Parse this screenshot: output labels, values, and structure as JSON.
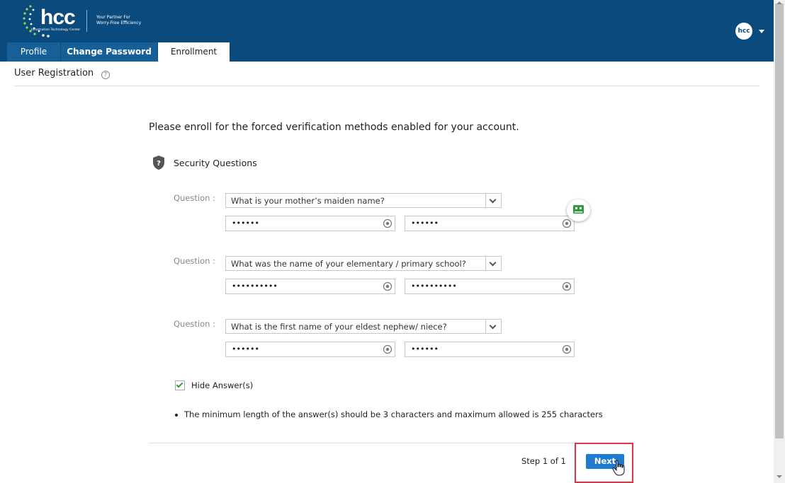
{
  "header": {
    "logo_text": "hcc",
    "logo_subtext": "Information Technology Center",
    "tagline_line1": "Your Partner For",
    "tagline_line2": "Worry-Free Efficiency",
    "avatar_text": "hcc"
  },
  "tabs": [
    {
      "label": "Profile",
      "active": false
    },
    {
      "label": "Change Password",
      "active": false
    },
    {
      "label": "Enrollment",
      "active": true
    }
  ],
  "page": {
    "title": "User Registration",
    "help": "?",
    "intro": "Please enroll for the forced verification methods enabled for your account."
  },
  "section": {
    "label": "Security Questions",
    "icon": "shield-question-icon"
  },
  "questions": [
    {
      "label": "Question :",
      "selected": "What is your mother’s maiden name?",
      "answer_masked": "••••••",
      "confirm_masked": "••••••"
    },
    {
      "label": "Question :",
      "selected": "What was the name of your elementary / primary school?",
      "answer_masked": "••••••••••",
      "confirm_masked": "••••••••••"
    },
    {
      "label": "Question :",
      "selected": "What is the first name of your eldest nephew/ niece?",
      "answer_masked": "••••••",
      "confirm_masked": "••••••"
    }
  ],
  "options": {
    "hide_answers_label": "Hide Answer(s)",
    "hide_answers_checked": true
  },
  "note": "The minimum length of the answer(s) should be 3 characters and maximum allowed is 255 characters",
  "footer": {
    "step": "Step 1 of 1",
    "next_label": "Next"
  },
  "colors": {
    "header_bg": "#0b4a7c",
    "tab_bg": "#165f97",
    "next_button": "#1f7bd0",
    "highlight": "#e0343f",
    "check": "#2e9e3a"
  }
}
